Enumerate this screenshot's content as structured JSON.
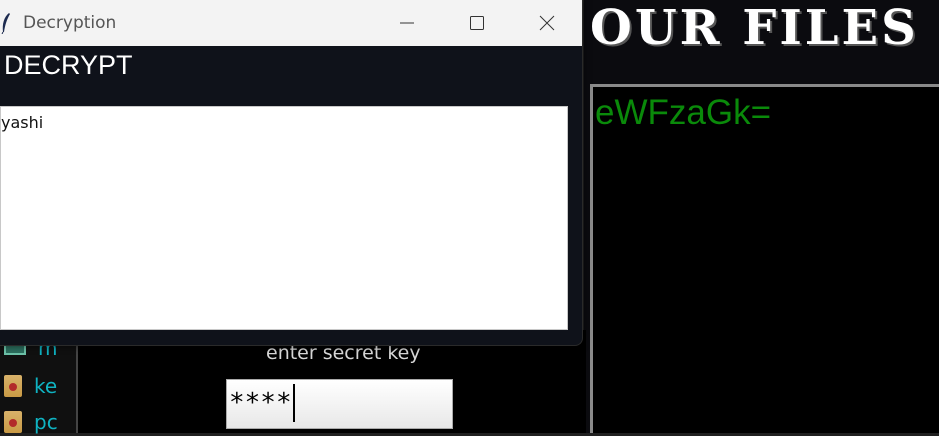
{
  "background_app": {
    "banner_text": "OUR FILES '",
    "output_text": "eWFzaGk=",
    "secret_key_label": "enter secret key",
    "secret_key_value": "****",
    "sidebar_items": [
      {
        "label": "m",
        "icon": "image-icon"
      },
      {
        "label": "ke",
        "icon": "file-key-icon"
      },
      {
        "label": "pc",
        "icon": "file-key-icon"
      }
    ]
  },
  "window": {
    "title": "Decryption",
    "heading": "DECRYPT",
    "text_content": "yashi",
    "controls": {
      "minimize": "minimize-icon",
      "maximize": "maximize-icon",
      "close": "close-icon"
    }
  },
  "colors": {
    "output_text": "#0a8a0a",
    "sidebar_text": "#0fb3c2",
    "window_dark": "#0f121a",
    "titlebar": "#f3f3f3"
  }
}
